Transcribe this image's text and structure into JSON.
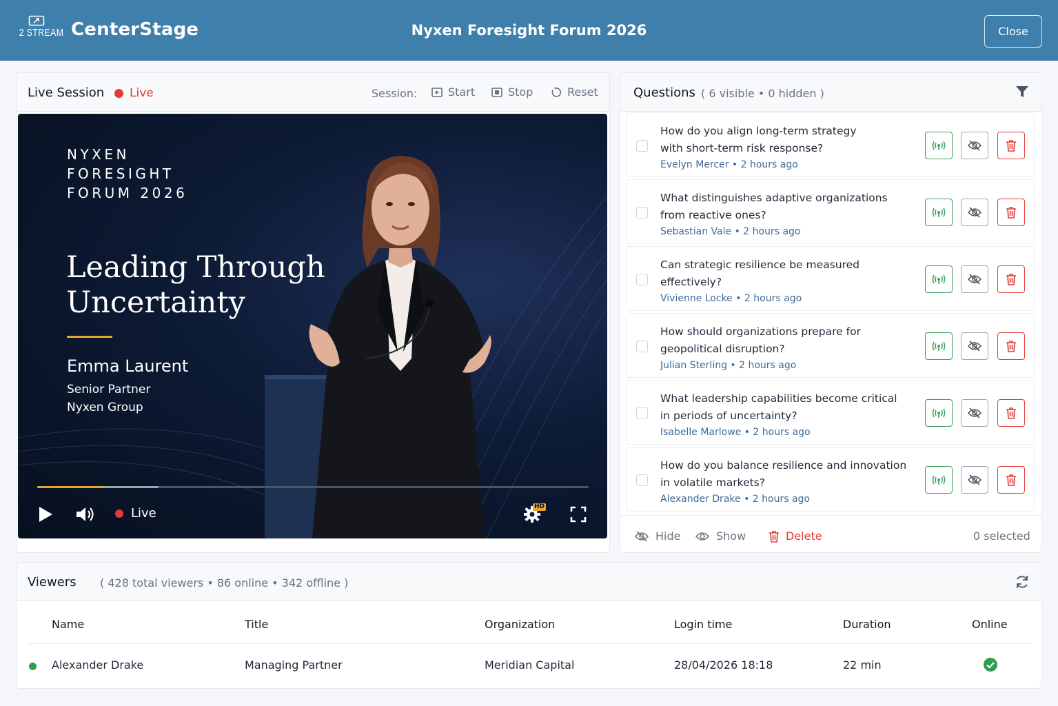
{
  "header": {
    "logo_text": "2 STREAM",
    "brand": "CenterStage",
    "event_title": "Nyxen Foresight Forum 2026",
    "close_label": "Close"
  },
  "live_session": {
    "title": "Live Session",
    "status": "Live",
    "session_label": "Session:",
    "controls": {
      "start": "Start",
      "stop": "Stop",
      "reset": "Reset"
    },
    "video": {
      "kicker": [
        "NYXEN",
        "FORESIGHT",
        "FORUM 2026"
      ],
      "title_lines": [
        "Leading Through",
        "Uncertainty"
      ],
      "speaker_name": "Emma Laurent",
      "speaker_role": "Senior Partner",
      "speaker_org": "Nyxen Group",
      "player_status": "Live",
      "quality_badge": "HD",
      "played_fraction": 0.12,
      "buffered_fraction": 0.22
    }
  },
  "questions": {
    "title": "Questions",
    "counts": "( 6 visible • 0 hidden )",
    "items": [
      {
        "text": [
          "How do you align long-term strategy",
          "with short-term risk response?"
        ],
        "meta": "Evelyn Mercer  •  2 hours ago"
      },
      {
        "text": [
          "What distinguishes adaptive organizations",
          "from reactive ones?"
        ],
        "meta": "Sebastian Vale  •  2 hours ago"
      },
      {
        "text": [
          "Can strategic resilience be measured",
          "effectively?"
        ],
        "meta": "Vivienne Locke  •  2 hours ago"
      },
      {
        "text": [
          "How should organizations prepare for",
          "geopolitical disruption?"
        ],
        "meta": "Julian Sterling  •  2 hours ago"
      },
      {
        "text": [
          "What leadership capabilities become critical",
          "in periods of uncertainty?"
        ],
        "meta": "Isabelle Marlowe  •  2 hours ago"
      },
      {
        "text": [
          "How do you balance resilience and innovation",
          "in volatile markets?"
        ],
        "meta": "Alexander Drake  •  2 hours ago"
      }
    ],
    "footer": {
      "hide": "Hide",
      "show": "Show",
      "delete": "Delete",
      "selected": "0 selected"
    }
  },
  "viewers": {
    "title": "Viewers",
    "counts": "( 428 total viewers  •  86 online  •  342 offline )",
    "columns": [
      "Name",
      "Title",
      "Organization",
      "Login time",
      "Duration",
      "Online"
    ],
    "rows": [
      {
        "name": "Alexander Drake",
        "title": "Managing Partner",
        "organization": "Meridian Capital",
        "login_time": "28/04/2026 18:18",
        "duration": "22 min",
        "online": true
      }
    ]
  },
  "colors": {
    "header_bg": "#3f7fab",
    "live_red": "#e53935",
    "live_green": "#3aa15b",
    "accent_gold": "#e0a72e",
    "link_blue": "#3d6b97"
  }
}
